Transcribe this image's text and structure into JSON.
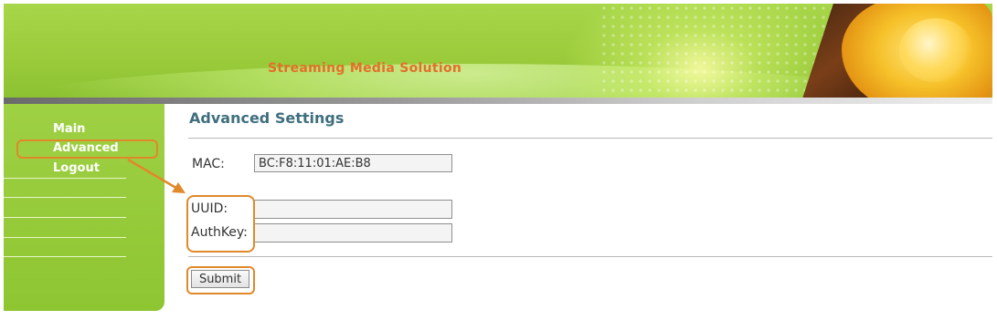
{
  "banner": {
    "title": "Streaming Media Solution"
  },
  "sidebar": {
    "items": [
      {
        "label": "Main"
      },
      {
        "label": "Advanced"
      },
      {
        "label": "Logout"
      }
    ]
  },
  "main": {
    "title": "Advanced Settings",
    "mac": {
      "label": "MAC:",
      "value": "BC:F8:11:01:AE:B8"
    },
    "uuid": {
      "label": "UUID:",
      "value": ""
    },
    "authkey": {
      "label": "AuthKey:",
      "value": ""
    },
    "submit_label": "Submit"
  },
  "colors": {
    "accent": "#e0892a",
    "sidebar": "#9fd044",
    "title": "#3f6f7e",
    "banner_text": "#e2702a"
  }
}
